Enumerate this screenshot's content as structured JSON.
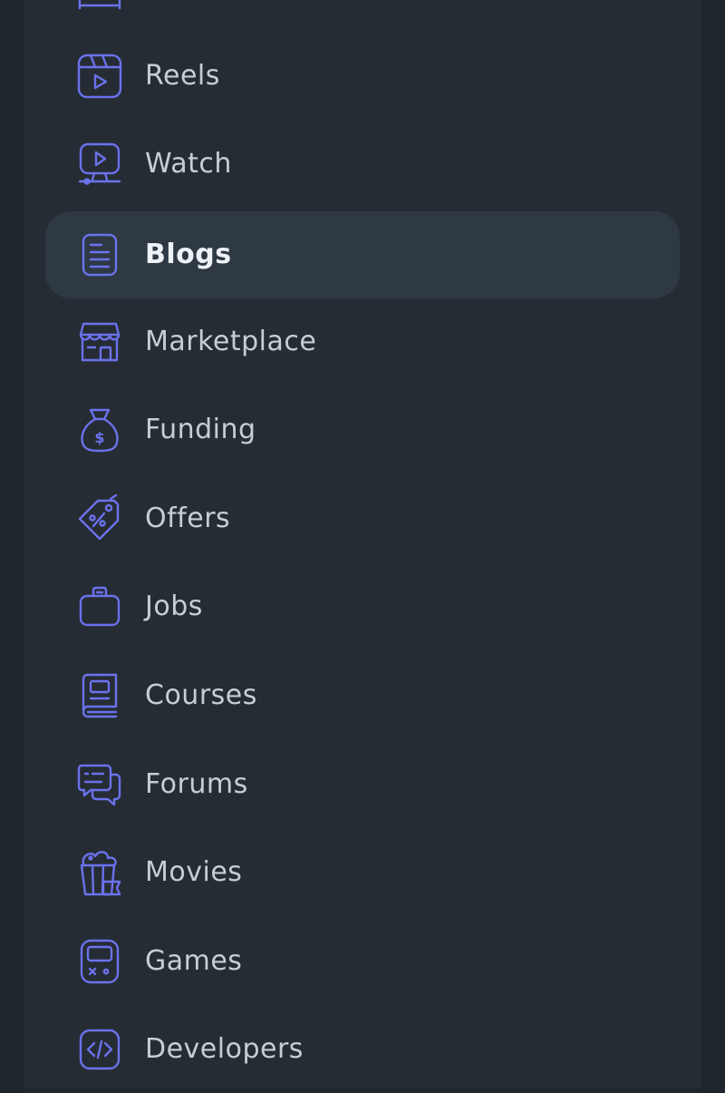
{
  "accent_color": "#6a72ec",
  "menu": {
    "items": [
      {
        "label": "",
        "icon": "partial-icon"
      },
      {
        "label": "Reels",
        "icon": "reels-icon"
      },
      {
        "label": "Watch",
        "icon": "watch-icon"
      },
      {
        "label": "Blogs",
        "icon": "blog-icon",
        "active": true
      },
      {
        "label": "Marketplace",
        "icon": "store-icon"
      },
      {
        "label": "Funding",
        "icon": "money-bag-icon"
      },
      {
        "label": "Offers",
        "icon": "tag-percent-icon"
      },
      {
        "label": "Jobs",
        "icon": "briefcase-icon"
      },
      {
        "label": "Courses",
        "icon": "book-icon"
      },
      {
        "label": "Forums",
        "icon": "chat-bubbles-icon"
      },
      {
        "label": "Movies",
        "icon": "popcorn-icon"
      },
      {
        "label": "Games",
        "icon": "gameboy-icon"
      },
      {
        "label": "Developers",
        "icon": "code-icon"
      }
    ]
  }
}
